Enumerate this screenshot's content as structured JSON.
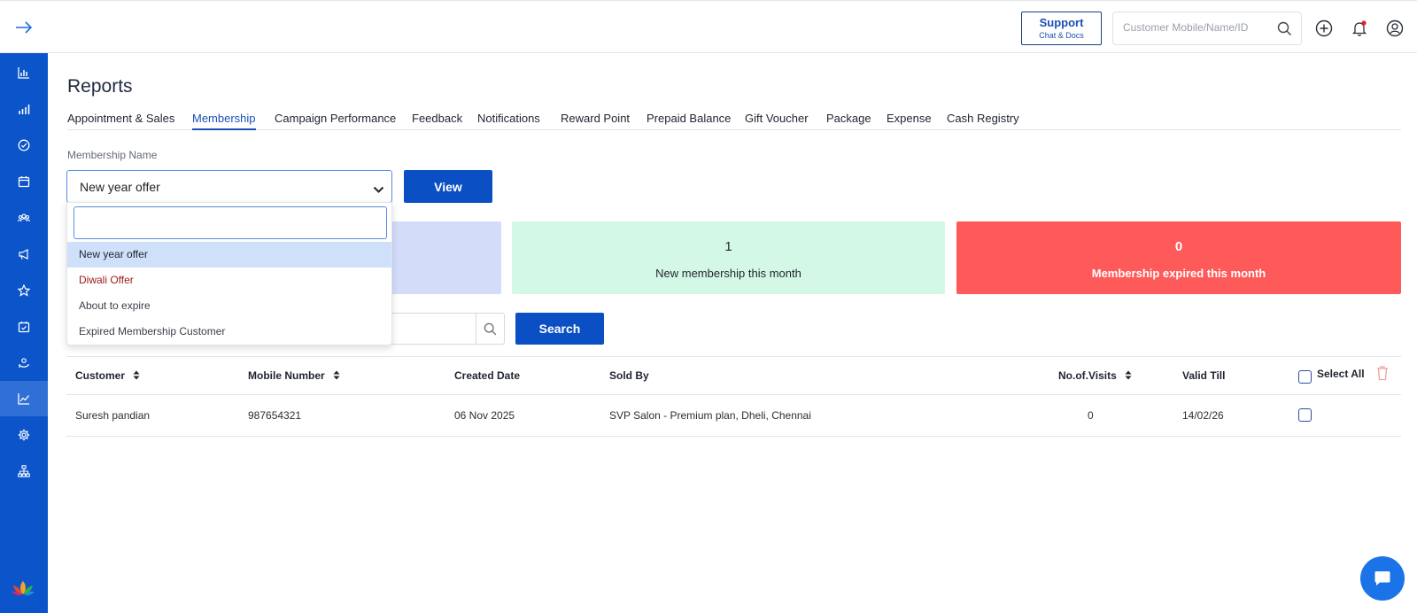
{
  "header": {
    "support_label": "Support",
    "support_sub": "Chat & Docs",
    "search_placeholder": "Customer Mobile/Name/ID"
  },
  "sidebar": {
    "items": [
      "dashboard",
      "analytics",
      "tasks",
      "calendar",
      "customers",
      "campaigns",
      "favorites",
      "appointments",
      "loyalty",
      "reports",
      "settings",
      "organization"
    ],
    "active": "reports"
  },
  "page": {
    "title": "Reports",
    "tabs": [
      "Appointment & Sales",
      "Membership",
      "Campaign Performance",
      "Feedback",
      "Notifications",
      "Reward Point",
      "Prepaid Balance",
      "Gift Voucher",
      "Package",
      "Expense",
      "Cash Registry"
    ],
    "active_tab": "Membership"
  },
  "filter": {
    "label": "Membership Name",
    "selected": "New year offer",
    "view_button": "View",
    "dropdown_search_value": "",
    "options": [
      "New year offer",
      "Diwali Offer",
      "About to expire",
      "Expired Membership Customer"
    ]
  },
  "cards": [
    {
      "value": "1",
      "label": "New membership this month"
    },
    {
      "value": "0",
      "label": "Membership expired this month"
    }
  ],
  "search": {
    "button": "Search"
  },
  "table": {
    "headers": {
      "customer": "Customer",
      "mobile": "Mobile Number",
      "created": "Created Date",
      "sold_by": "Sold By",
      "visits": "No.of.Visits",
      "valid_till": "Valid Till",
      "select_all": "Select All"
    },
    "rows": [
      {
        "customer": "Suresh pandian",
        "mobile": "987654321",
        "created": "06 Nov 2025",
        "sold_by": "SVP Salon - Premium plan, Dheli, Chennai",
        "visits": "0",
        "valid_till": "14/02/26"
      }
    ]
  },
  "colors": {
    "primary": "#0b4fc4",
    "sidebar": "#0b54c9",
    "card_blue": "#d3dcf9",
    "card_green": "#d4f8e6",
    "card_red": "#ff5a5a",
    "option_red": "#a01a1a"
  }
}
